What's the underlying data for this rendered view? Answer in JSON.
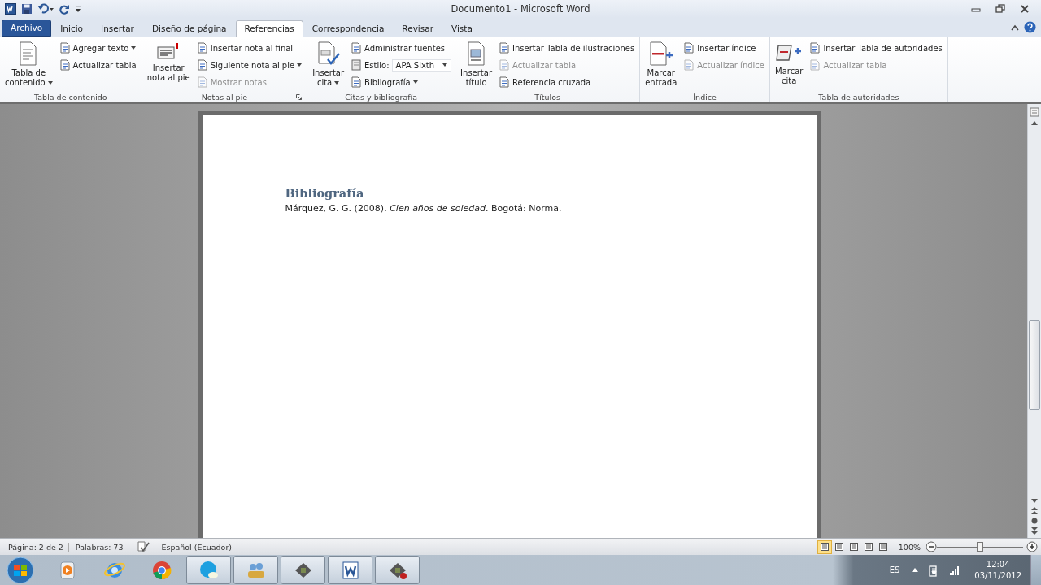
{
  "window": {
    "title": "Documento1 - Microsoft Word"
  },
  "tabs": [
    {
      "label": "Archivo",
      "kind": "file",
      "selected": false
    },
    {
      "label": "Inicio",
      "kind": "tab",
      "selected": false
    },
    {
      "label": "Insertar",
      "kind": "tab",
      "selected": false
    },
    {
      "label": "Diseño de página",
      "kind": "tab",
      "selected": false
    },
    {
      "label": "Referencias",
      "kind": "tab",
      "selected": true
    },
    {
      "label": "Correspondencia",
      "kind": "tab",
      "selected": false
    },
    {
      "label": "Revisar",
      "kind": "tab",
      "selected": false
    },
    {
      "label": "Vista",
      "kind": "tab",
      "selected": false
    }
  ],
  "ribbon": {
    "groups": [
      {
        "label": "Tabla de contenido",
        "launcher": false,
        "large": [
          {
            "label": "Tabla de\ncontenido",
            "dropdown": true
          }
        ],
        "small": [
          {
            "kind": "button",
            "label": "Agregar texto",
            "dropdown": true,
            "disabled": false
          },
          {
            "kind": "button",
            "label": "Actualizar tabla",
            "dropdown": false,
            "disabled": false
          }
        ]
      },
      {
        "label": "Notas al pie",
        "launcher": true,
        "large": [
          {
            "label": "Insertar\nnota al pie",
            "dropdown": false
          }
        ],
        "small": [
          {
            "kind": "button",
            "label": "Insertar nota al final",
            "dropdown": false,
            "disabled": false
          },
          {
            "kind": "button",
            "label": "Siguiente nota al pie",
            "dropdown": true,
            "disabled": false
          },
          {
            "kind": "button",
            "label": "Mostrar notas",
            "dropdown": false,
            "disabled": true
          }
        ]
      },
      {
        "label": "Citas y bibliografía",
        "launcher": false,
        "large": [
          {
            "label": "Insertar\ncita",
            "dropdown": true
          }
        ],
        "small": [
          {
            "kind": "button",
            "label": "Administrar fuentes",
            "dropdown": false,
            "disabled": false
          },
          {
            "kind": "combo",
            "label": "Estilo:",
            "value": "APA Sixth",
            "dropdown": true,
            "disabled": false
          },
          {
            "kind": "button",
            "label": "Bibliografía",
            "dropdown": true,
            "disabled": false
          }
        ]
      },
      {
        "label": "Títulos",
        "launcher": false,
        "large": [
          {
            "label": "Insertar\ntítulo",
            "dropdown": false
          }
        ],
        "small": [
          {
            "kind": "button",
            "label": "Insertar Tabla de ilustraciones",
            "dropdown": false,
            "disabled": false
          },
          {
            "kind": "button",
            "label": "Actualizar tabla",
            "dropdown": false,
            "disabled": true
          },
          {
            "kind": "button",
            "label": "Referencia cruzada",
            "dropdown": false,
            "disabled": false
          }
        ]
      },
      {
        "label": "Índice",
        "launcher": false,
        "large": [
          {
            "label": "Marcar\nentrada",
            "dropdown": false
          }
        ],
        "small": [
          {
            "kind": "button",
            "label": "Insertar índice",
            "dropdown": false,
            "disabled": false
          },
          {
            "kind": "button",
            "label": "Actualizar índice",
            "dropdown": false,
            "disabled": true
          }
        ]
      },
      {
        "label": "Tabla de autoridades",
        "launcher": false,
        "large": [
          {
            "label": "Marcar\ncita",
            "dropdown": false
          }
        ],
        "small": [
          {
            "kind": "button",
            "label": "Insertar Tabla de autoridades",
            "dropdown": false,
            "disabled": false
          },
          {
            "kind": "button",
            "label": "Actualizar tabla",
            "dropdown": false,
            "disabled": true
          }
        ]
      }
    ]
  },
  "document": {
    "heading": "Bibliografía",
    "entry": "Márquez, G. G. (2008). *Cien años de soledad*. Bogotá: Norma."
  },
  "status_bar": {
    "page": "Página: 2 de 2",
    "words": "Palabras: 73",
    "language": "Español (Ecuador)",
    "views": [
      {
        "selected": true
      },
      {
        "selected": false
      },
      {
        "selected": false
      },
      {
        "selected": false
      },
      {
        "selected": false
      }
    ],
    "zoom": "100%",
    "zoom_slider": {
      "level": 0.5
    }
  },
  "taskbar": {
    "apps": [
      {
        "open": false
      },
      {
        "open": false
      },
      {
        "open": false
      },
      {
        "open": true
      },
      {
        "open": true
      },
      {
        "open": true
      },
      {
        "open": true
      },
      {
        "open": true
      }
    ],
    "language": "ES",
    "time": "12:04",
    "date": "03/11/2012"
  }
}
